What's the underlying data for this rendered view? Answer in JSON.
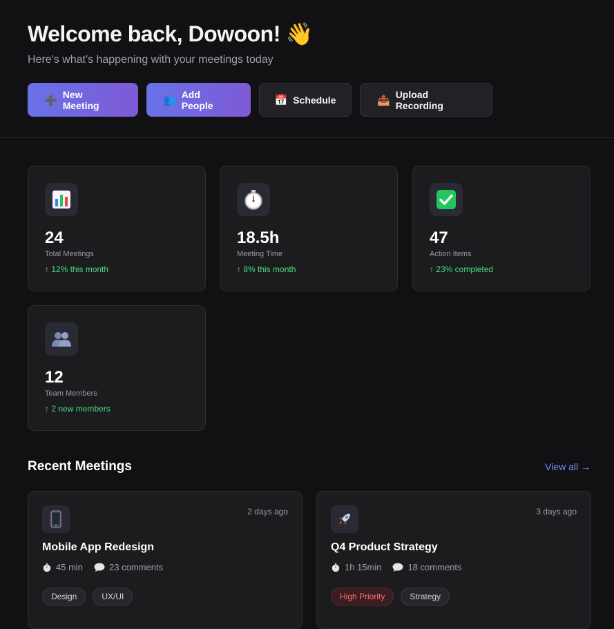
{
  "header": {
    "welcome": "Welcome back, Dowoon!",
    "welcome_emoji": "👋",
    "subtitle": "Here's what's happening with your meetings today"
  },
  "actions": [
    {
      "icon": "➕",
      "icon_name": "plus-icon",
      "label": "New Meeting",
      "style": "primary"
    },
    {
      "icon": "👥",
      "icon_name": "people-icon",
      "label": "Add People",
      "style": "primary"
    },
    {
      "icon": "📅",
      "icon_name": "calendar-icon",
      "label": "Schedule",
      "style": "secondary"
    },
    {
      "icon": "📤",
      "icon_name": "upload-icon",
      "label": "Upload Recording",
      "style": "secondary"
    }
  ],
  "stats": [
    {
      "icon_name": "bar-chart-icon",
      "value": "24",
      "label": "Total Meetings",
      "change": "↑ 12% this month"
    },
    {
      "icon_name": "stopwatch-icon",
      "value": "18.5h",
      "label": "Meeting Time",
      "change": "↑ 8% this month"
    },
    {
      "icon_name": "check-box-icon",
      "value": "47",
      "label": "Action Items",
      "change": "↑ 23% completed"
    },
    {
      "icon_name": "team-icon",
      "value": "12",
      "label": "Team Members",
      "change": "↑ 2 new members"
    }
  ],
  "recent": {
    "title": "Recent Meetings",
    "view_all": "View all →",
    "meetings": [
      {
        "icon_name": "phone-icon",
        "time_ago": "2 days ago",
        "title": "Mobile App Redesign",
        "duration": "45 min",
        "comments": "23 comments",
        "tags": [
          "Design",
          "UX/UI"
        ]
      },
      {
        "icon_name": "rocket-icon",
        "time_ago": "3 days ago",
        "title": "Q4 Product Strategy",
        "duration": "1h 15min",
        "comments": "18 comments",
        "tags": [
          "High Priority",
          "Strategy"
        ]
      }
    ]
  },
  "colors": {
    "background": "#111113",
    "card": "#1c1c1f",
    "accent": "#6872e6",
    "positive": "#4ade80",
    "link": "#818cf8",
    "priority": "#f87171"
  }
}
